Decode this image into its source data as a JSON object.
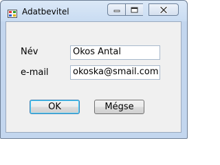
{
  "window": {
    "title": "Adatbevitel"
  },
  "form": {
    "name_label": "Név",
    "name_value": "Okos Antal",
    "email_label": "e-mail",
    "email_value": "okoska@smail.com"
  },
  "buttons": {
    "ok_label": "OK",
    "cancel_label": "Mégse"
  },
  "icons": {
    "app": "app-icon",
    "minimize": "minimize-icon",
    "maximize": "maximize-icon",
    "close": "close-icon"
  }
}
